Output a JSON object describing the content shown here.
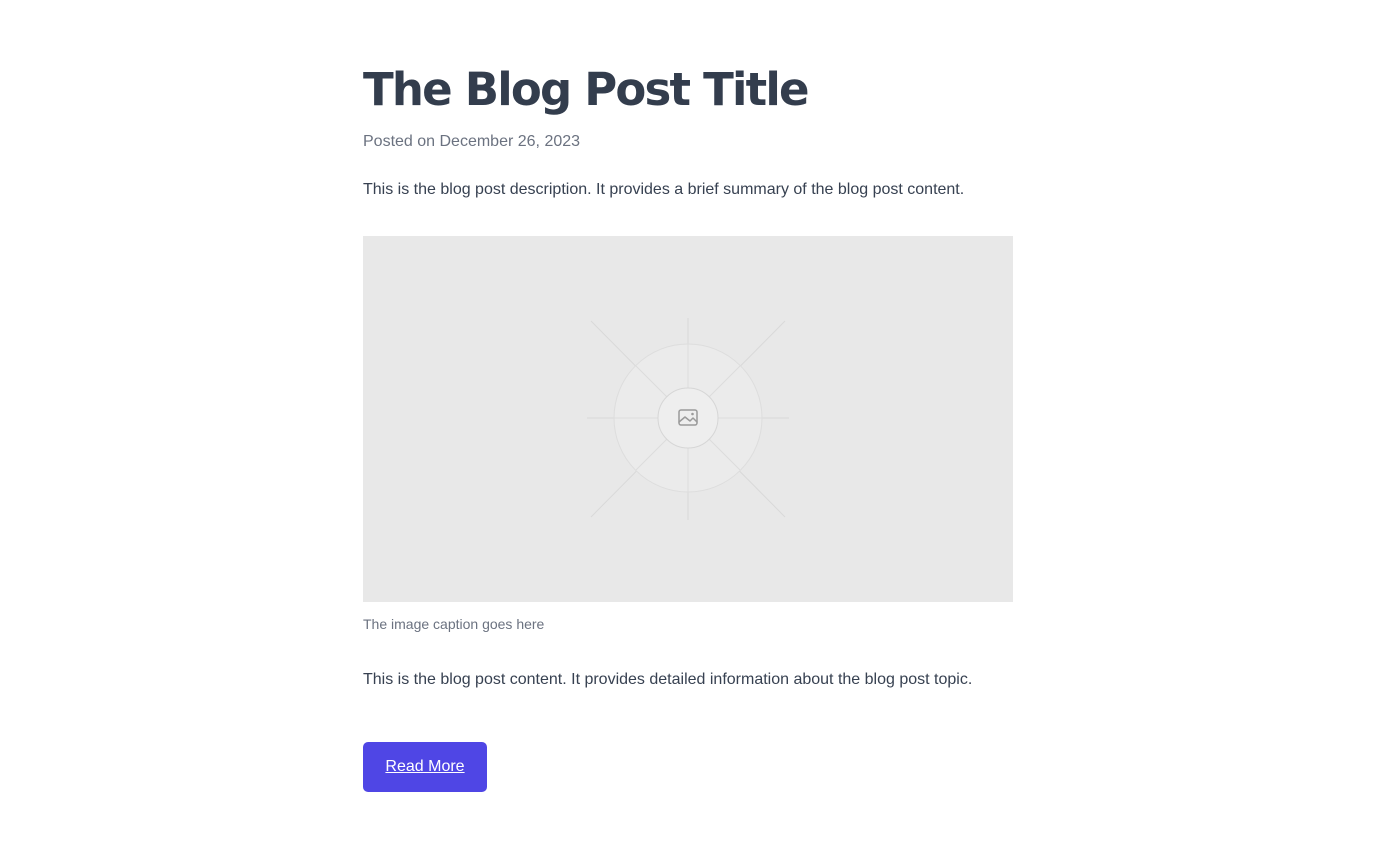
{
  "post": {
    "title": "The Blog Post Title",
    "date": "Posted on December 26, 2023",
    "description": "This is the blog post description. It provides a brief summary of the blog post content.",
    "image": {
      "icon": "image-icon",
      "caption": "The image caption goes here",
      "placeholder_color": "#e8e8e8"
    },
    "content": "This is the blog post content. It provides detailed information about the blog post topic.",
    "cta_label": "Read More"
  },
  "colors": {
    "heading": "#333d4d",
    "muted": "#6b7280",
    "body": "#374151",
    "accent": "#4f46e5"
  }
}
